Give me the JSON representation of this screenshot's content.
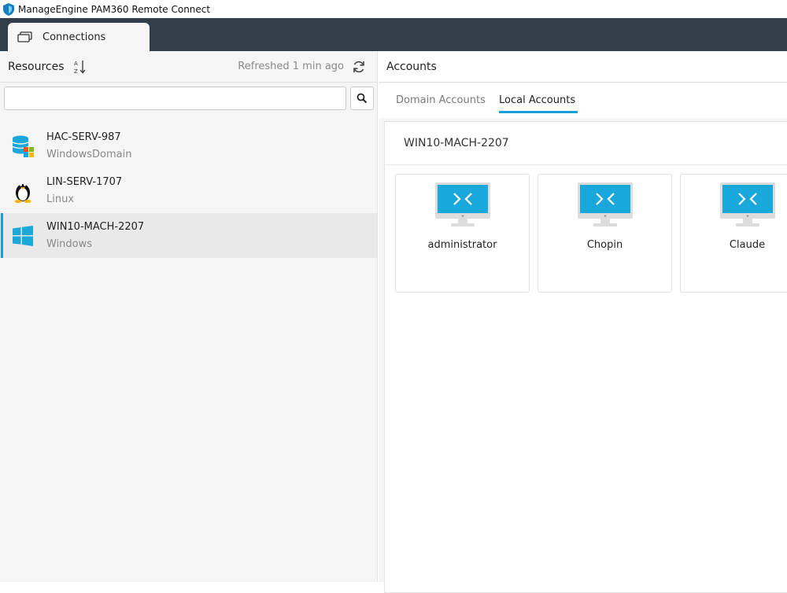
{
  "window": {
    "title": "ManageEngine PAM360 Remote Connect"
  },
  "tabs": [
    {
      "label": "Connections",
      "icon": "monitor-tab-icon"
    }
  ],
  "resources": {
    "title": "Resources",
    "refreshed": "Refreshed 1 min ago",
    "search_placeholder": "",
    "items": [
      {
        "name": "HAC-SERV-987",
        "type": "WindowsDomain",
        "icon": "database-windows-icon",
        "selected": false
      },
      {
        "name": "LIN-SERV-1707",
        "type": "Linux",
        "icon": "linux-penguin-icon",
        "selected": false
      },
      {
        "name": "WIN10-MACH-2207",
        "type": "Windows",
        "icon": "windows-logo-icon",
        "selected": true
      }
    ]
  },
  "accounts": {
    "title": "Accounts",
    "subtabs": [
      {
        "label": "Domain Accounts",
        "active": false
      },
      {
        "label": "Local Accounts",
        "active": true
      }
    ],
    "resource_name": "WIN10-MACH-2207",
    "cards": [
      {
        "label": "administrator"
      },
      {
        "label": "Chopin"
      },
      {
        "label": "Claude"
      }
    ]
  },
  "colors": {
    "accent": "#1a9fd8",
    "tabstrip": "#323e4a",
    "monitor": "#1aa7d9"
  }
}
